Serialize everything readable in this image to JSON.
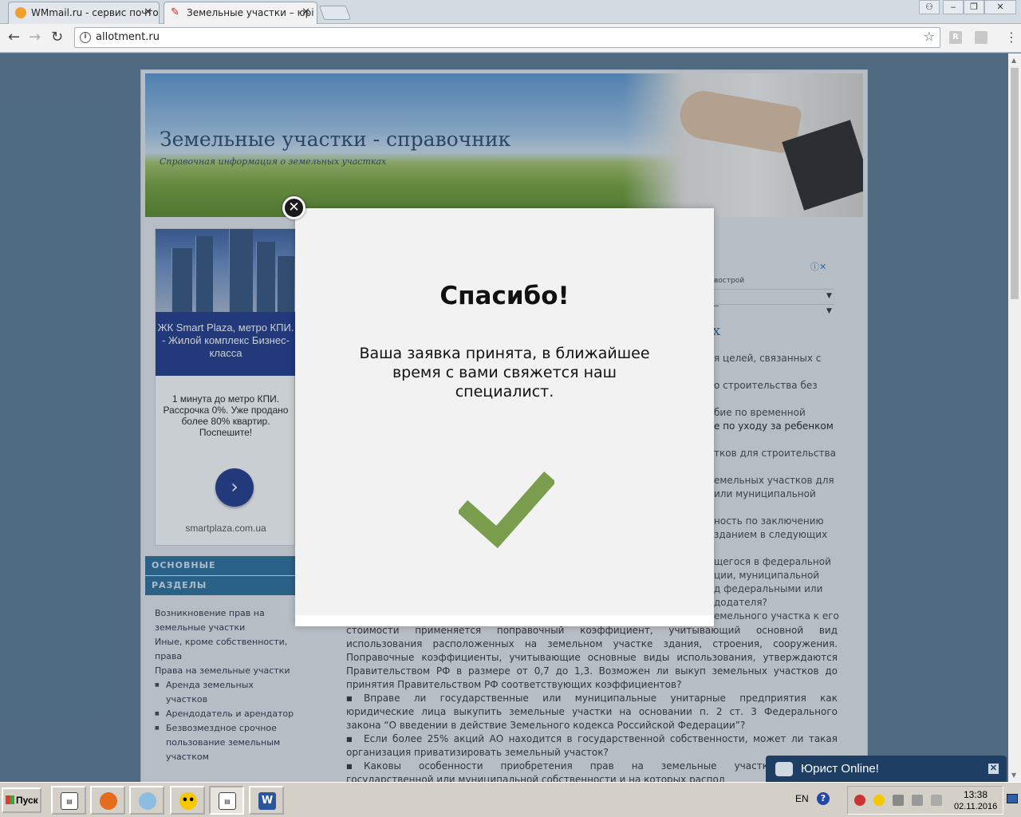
{
  "browser": {
    "tabs": [
      {
        "title": "WMmail.ru - сервис почтов",
        "active": false
      },
      {
        "title": "Земельные участки – юрі",
        "active": true
      }
    ],
    "url": "allotment.ru"
  },
  "site": {
    "title": "Земельные участки - справочник",
    "subtitle": "Справочная информация о земельных участках"
  },
  "left_ad": {
    "headline": "ЖК Smart Plaza, метро КПИ. - Жилой комплекс Бизнес-класса",
    "body": "1 минута до метро КПИ. Рассрочка 0%. Уже продано более 80% квартир. Поспешите!",
    "domain": "smartplaza.com.ua"
  },
  "sidebar": {
    "section1": "ОСНОВНЫЕ",
    "section2": "РАЗДЕЛЫ",
    "links": [
      "Возникновение прав на земельные участки",
      "Иные, кроме собственности, права",
      "Права на земельные участки"
    ],
    "sublinks": [
      "Аренда земельных участков",
      "Арендодатель и арендатор",
      "Безвозмездное срочное пользование земельным участком"
    ]
  },
  "right_ad": {
    "label": "вострой"
  },
  "content": {
    "frag1": "х",
    "frag2": "я целей, связанных с",
    "frag3": "о   строительства   без",
    "frag4": "бие    по    временной",
    "frag5": "е по уходу за ребенком",
    "frag6": "тков для строительства",
    "frag7": "емельных   участков   для",
    "frag8": "или     муниципальной",
    "frag9": "ность по заключению",
    "frag10": "зданием в следующих",
    "frag11": "щегося в федеральной",
    "frag12": "ции,     муниципальной",
    "frag13": "д    федеральными    или",
    "frag14": "додателя?",
    "frag15": "емельного участка к его",
    "para_lines": [
      "стоимости применяется поправочный коэффициент, учитывающий основной вид",
      "использования расположенных на земельном участке здания, строения, сооружения.",
      "Поправочные коэффициенты, учитывающие основные виды использования, утверждаются",
      "Правительством РФ в размере от 0,7 до 1,3. Возможен ли выкуп земельных участков до",
      "принятия Правительством РФ соответствующих коэффициентов?"
    ],
    "bullet1": [
      "Вправе ли государственные или муниципальные унитарные предприятия как",
      "юридические лица выкупить земельные участки на основании п. 2 ст. 3 Федерального",
      "закона “О введении в действие Земельного кодекса Российской Федерации”?"
    ],
    "bullet2": [
      "Если более 25% акций АО находится в государственной собственности, может ли такая",
      "организация приватизировать земельный участок?"
    ],
    "bullet3": [
      "Каковы особенности приобретения прав на земельные участки, которые",
      "государственной или муниципальной собственности и на которых распол"
    ]
  },
  "modal": {
    "title": "Спасибо!",
    "message": "Ваша заявка принята, в ближайшее время с вами свяжется наш специалист.",
    "close_symbol": "✕",
    "check_color": "#7a9e4e"
  },
  "chat": {
    "label": "Юрист Online!"
  },
  "taskbar": {
    "start_label": "Пуск",
    "lang": "EN",
    "time": "13:38",
    "date": "02.11.2016"
  },
  "icons": [
    "info-icon",
    "star-icon",
    "back-icon",
    "forward-icon",
    "reload-icon",
    "close-icon",
    "check-icon",
    "chat-icon",
    "help-icon"
  ]
}
